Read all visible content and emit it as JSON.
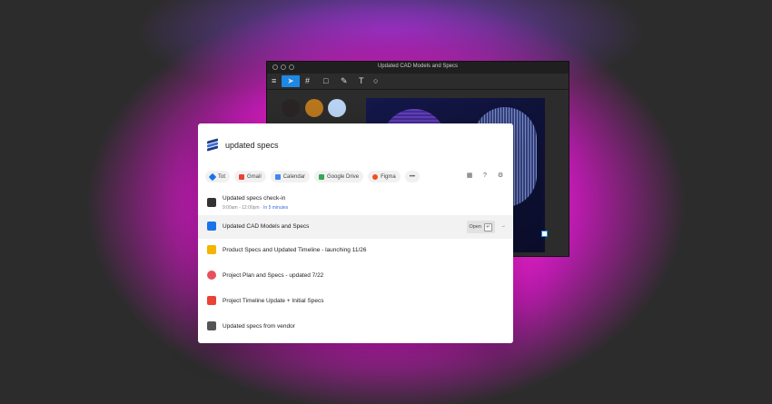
{
  "figma_window": {
    "title": "Updated CAD Models and Specs",
    "toolbar_icons": [
      "menu-icon",
      "move-tool-icon",
      "frame-tool-icon",
      "shape-tool-icon",
      "pen-tool-icon",
      "text-tool-icon",
      "comment-tool-icon"
    ],
    "swatches": [
      "#2a2424",
      "#b8761e",
      "#b9d3f2",
      "#d9503a",
      "#e6e6e6",
      "#f0c24a"
    ]
  },
  "palette": {
    "query": "updated specs",
    "chips": [
      {
        "label": "Tot",
        "color": "#1a73e8"
      },
      {
        "label": "Gmail",
        "color": "#ea4335"
      },
      {
        "label": "Calendar",
        "color": "#4285f4"
      },
      {
        "label": "Google Drive",
        "color": "#34a853"
      },
      {
        "label": "Figma",
        "color": "#f24e1e"
      },
      {
        "label": "•••",
        "color": ""
      }
    ],
    "results": [
      {
        "title": "Updated specs check-in",
        "sub": "9:00am - 12:00pm · ",
        "link": "In 5 minutes",
        "icon_color": "#333"
      },
      {
        "title": "Updated CAD Models and Specs",
        "sub": "",
        "link": "",
        "icon_color": "#1a73e8"
      },
      {
        "title": "Product Specs and Updated Timeline - launching 11/26",
        "sub": "",
        "link": "",
        "icon_color": "#f4b400"
      },
      {
        "title": "Project Plan and Specs - updated 7/22",
        "sub": "",
        "link": "",
        "icon_color": "#e8505b"
      },
      {
        "title": "Project Timeline Update + Initial Specs",
        "sub": "",
        "link": "",
        "icon_color": "#ea4335"
      },
      {
        "title": "Updated specs from vendor",
        "sub": "",
        "link": "",
        "icon_color": "#555"
      }
    ],
    "open_label": "Open",
    "open_key": "↵"
  }
}
